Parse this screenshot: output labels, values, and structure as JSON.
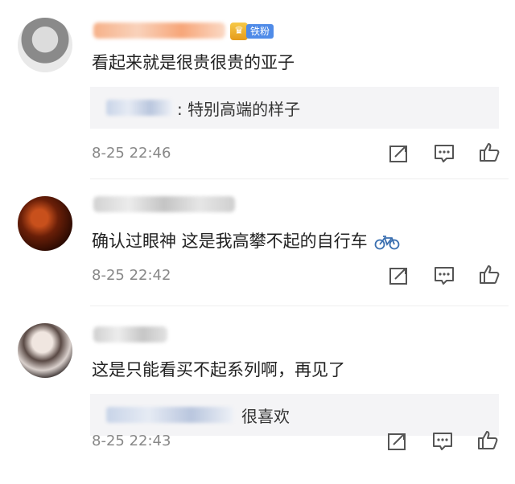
{
  "comments": [
    {
      "text": "看起来就是很贵很贵的亚子",
      "badge": "铁粉",
      "reply": ": 特别高端的样子",
      "time": "8-25 22:46"
    },
    {
      "text": "确认过眼神 这是我高攀不起的自行车",
      "time": "8-25 22:42"
    },
    {
      "text": "这是只能看买不起系列啊，再见了",
      "reply": "很喜欢",
      "time": "8-25 22:43"
    }
  ],
  "icons": {
    "share": "share-icon",
    "comment": "comment-icon",
    "like": "thumbs-up-icon",
    "emoji": "bicycle-emoji",
    "badge": "crown-icon"
  },
  "colors": {
    "badge_blue": "#4f8be8",
    "crown_gold": "#f2b53a",
    "name_orange": "#f7b48a",
    "reply_bg": "#f4f4f6",
    "time_gray": "#888888"
  }
}
